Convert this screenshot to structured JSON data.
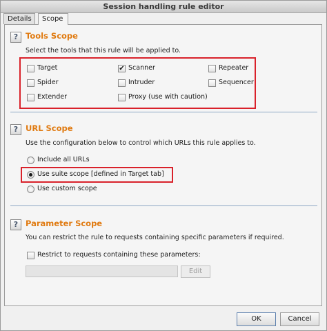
{
  "window": {
    "title": "Session handling rule editor"
  },
  "tabs": [
    {
      "label": "Details",
      "active": false
    },
    {
      "label": "Scope",
      "active": true
    }
  ],
  "tools_scope": {
    "help": "?",
    "title": "Tools Scope",
    "description": "Select the tools that this rule will be applied to.",
    "tools": [
      {
        "label": "Target",
        "checked": false
      },
      {
        "label": "Scanner",
        "checked": true
      },
      {
        "label": "Repeater",
        "checked": false
      },
      {
        "label": "Spider",
        "checked": false
      },
      {
        "label": "Intruder",
        "checked": false
      },
      {
        "label": "Sequencer",
        "checked": false
      },
      {
        "label": "Extender",
        "checked": false
      },
      {
        "label": "Proxy (use with caution)",
        "checked": false
      }
    ],
    "check_mark": "✔"
  },
  "url_scope": {
    "help": "?",
    "title": "URL Scope",
    "description": "Use the configuration below to control which URLs this rule applies to.",
    "options": [
      {
        "label": "Include all URLs",
        "selected": false
      },
      {
        "label": "Use suite scope [defined in Target tab]",
        "selected": true
      },
      {
        "label": "Use custom scope",
        "selected": false
      }
    ]
  },
  "parameter_scope": {
    "help": "?",
    "title": "Parameter Scope",
    "description": "You can restrict the rule to requests containing specific parameters if required.",
    "restrict_label": "Restrict to requests containing these parameters:",
    "restrict_checked": false,
    "parameters_value": "",
    "edit_label": "Edit"
  },
  "footer": {
    "ok_label": "OK",
    "cancel_label": "Cancel"
  },
  "colors": {
    "section_title": "#e07a10",
    "highlight_box": "#d9212a",
    "divider": "#8ca6c4"
  }
}
